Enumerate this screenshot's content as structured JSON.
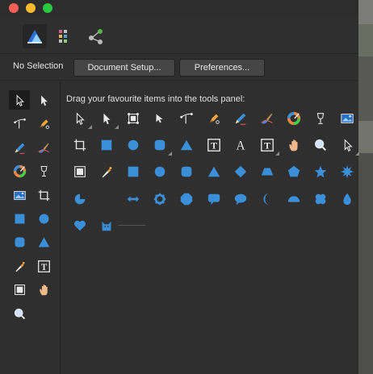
{
  "titlebar": {
    "lights": [
      {
        "name": "close-button",
        "color": "#fd5f57"
      },
      {
        "name": "minimize-button",
        "color": "#fdbc2e"
      },
      {
        "name": "zoom-button",
        "color": "#28c840"
      }
    ]
  },
  "personas": [
    {
      "name": "photo-persona-tab",
      "icon": "affinity-photo-icon",
      "active": true
    },
    {
      "name": "liquify-persona-tab",
      "icon": "liquify-grid-icon",
      "active": false
    },
    {
      "name": "export-persona-tab",
      "icon": "export-nodes-icon",
      "active": false
    }
  ],
  "context": {
    "selection_label": "No Selection",
    "document_setup_label": "Document Setup...",
    "preferences_label": "Preferences..."
  },
  "customize": {
    "hint": "Drag your favourite items into the tools panel:"
  },
  "colors": {
    "accent": "#3b8fd9",
    "icon_light": "#e8e8e8",
    "background": "#2f2f2f"
  },
  "toolbar_tools": [
    [
      "move-tool-icon",
      "node-tool-icon"
    ],
    [
      "corner-tool-icon",
      "pen-tool-icon"
    ],
    [
      "pencil-tool-icon",
      "vector-brush-tool-icon"
    ],
    [
      "fill-tool-icon",
      "transparency-tool-icon"
    ],
    [
      "place-image-tool-icon",
      "crop-tool-icon"
    ],
    [
      "rectangle-tool-icon",
      "ellipse-tool-icon"
    ],
    [
      "rounded-rectangle-tool-icon",
      "triangle-tool-icon"
    ],
    [
      "color-picker-tool-icon",
      "frame-text-tool-icon"
    ],
    [
      "table-tool-icon",
      "view-tool-icon"
    ],
    [
      "zoom-tool-icon"
    ]
  ],
  "favourite_items": [
    [
      "move-tool-icon",
      "node-tool-icon",
      "transform-tool-icon",
      "point-transform-icon",
      "corner-tool-icon",
      "pen-tool-icon",
      "pencil-tool-icon",
      "vector-brush-tool-icon",
      "fill-tool-icon",
      "transparency-tool-icon",
      "place-image-tool-icon"
    ],
    [
      "crop-tool-icon",
      "rectangle-tool-icon",
      "ellipse-tool-icon",
      "rounded-rectangle-tool-icon",
      "triangle-tool-icon",
      "frame-text-tool-icon",
      "artistic-text-tool-icon",
      "text-frame-tool-icon",
      "view-tool-icon",
      "zoom-tool-icon",
      "select-pointer-icon"
    ],
    [
      "table-tool-icon",
      "color-picker-tool-icon",
      "square-shape-icon",
      "circle-shape-icon",
      "rounded-square-shape-icon",
      "triangle-shape-icon",
      "diamond-shape-icon",
      "trapezoid-shape-icon",
      "pentagon-shape-icon",
      "star-shape-icon",
      "burst-shape-icon"
    ],
    [
      "pie-shape-icon",
      "blank-slot",
      "double-arrow-shape-icon",
      "cog-shape-icon",
      "polygon-shape-icon",
      "callout-rect-icon",
      "callout-ellipse-icon",
      "crescent-shape-icon",
      "segment-shape-icon",
      "cloud-shape-icon",
      "tear-shape-icon"
    ],
    [
      "heart-shape-icon",
      "cat-shape-icon"
    ]
  ]
}
